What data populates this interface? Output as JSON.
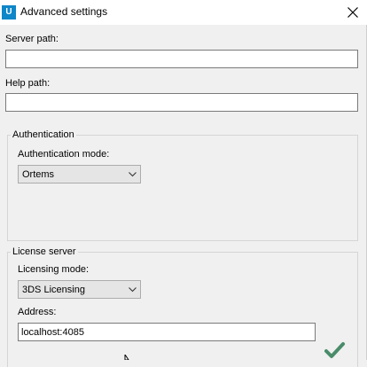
{
  "window": {
    "title": "Advanced settings",
    "app_icon_letter": "U",
    "accent_color": "#0e86c8"
  },
  "fields": {
    "server_path": {
      "label": "Server path:",
      "value": ""
    },
    "help_path": {
      "label": "Help path:",
      "value": ""
    }
  },
  "authentication": {
    "group_title": "Authentication",
    "mode_label": "Authentication mode:",
    "mode_value": "Ortems"
  },
  "license_server": {
    "group_title": "License server",
    "mode_label": "Licensing mode:",
    "mode_value": "3DS Licensing",
    "address_label": "Address:",
    "address_value": "localhost:4085"
  },
  "icons": {
    "close": "close-icon",
    "confirm": "checkmark-icon",
    "dropdown": "chevron-down-icon",
    "confirm_color": "#4a8c6a"
  }
}
